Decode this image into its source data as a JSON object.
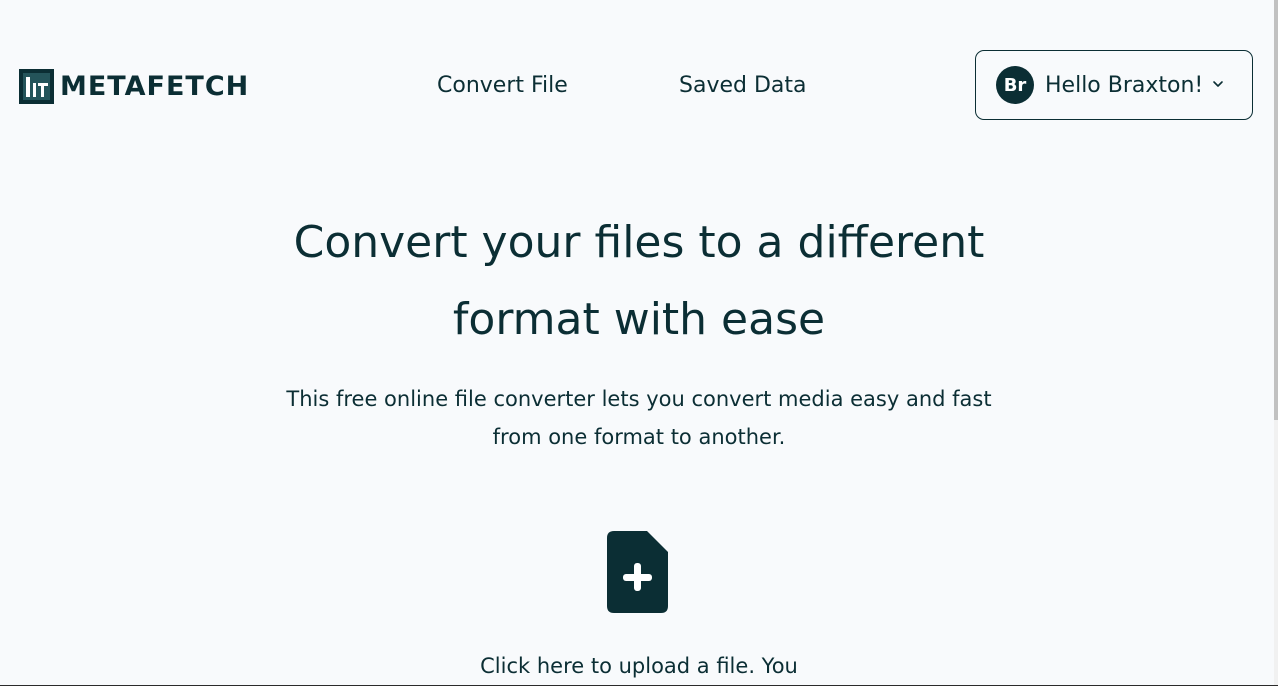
{
  "header": {
    "logo_text": "METAFETCH",
    "nav": {
      "convert_file": "Convert File",
      "saved_data": "Saved Data"
    },
    "user": {
      "avatar_initials": "Br",
      "greeting": "Hello Braxton!"
    }
  },
  "hero": {
    "title_line1": "Convert your files to a different",
    "title_line2": "format with ease",
    "subtitle_line1": "This free online file converter lets you convert media easy and fast",
    "subtitle_line2": "from one format to another."
  },
  "upload": {
    "icon": "file-plus-icon",
    "text": "Click here to upload a file. You"
  },
  "colors": {
    "background": "#f8fafc",
    "primary": "#0b2e34"
  }
}
